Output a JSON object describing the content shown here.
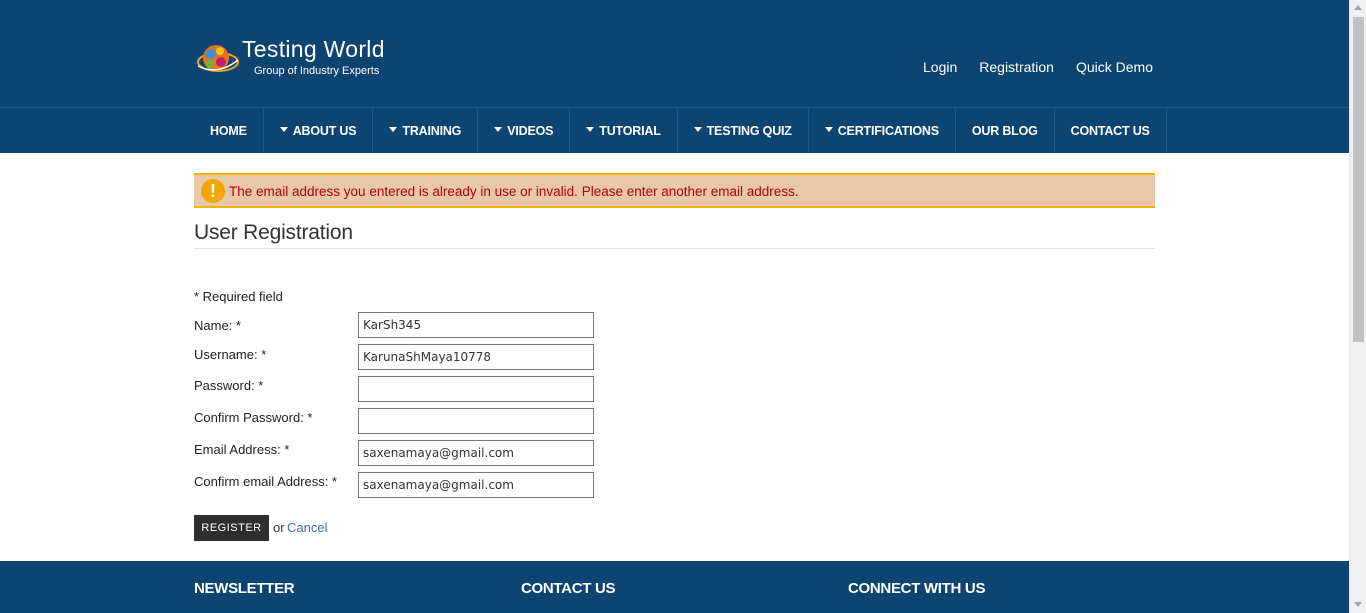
{
  "header": {
    "logo_title": "Testing World",
    "logo_subtitle": "Group of Industry Experts",
    "top_links": [
      "Login",
      "Registration",
      "Quick Demo"
    ]
  },
  "nav": {
    "items": [
      {
        "label": "HOME",
        "dropdown": false
      },
      {
        "label": "ABOUT US",
        "dropdown": true
      },
      {
        "label": "TRAINING",
        "dropdown": true
      },
      {
        "label": "VIDEOS",
        "dropdown": true
      },
      {
        "label": "TUTORIAL",
        "dropdown": true
      },
      {
        "label": "TESTING QUIZ",
        "dropdown": true
      },
      {
        "label": "CERTIFICATIONS",
        "dropdown": true
      },
      {
        "label": "OUR BLOG",
        "dropdown": false
      },
      {
        "label": "CONTACT US",
        "dropdown": false
      }
    ]
  },
  "alert": {
    "icon": "exclamation-icon",
    "message": "The email address you entered is already in use or invalid. Please enter another email address."
  },
  "form": {
    "title": "User Registration",
    "required_note": "* Required field",
    "fields": {
      "name": {
        "label": "Name: *",
        "value": "KarSh345"
      },
      "username": {
        "label": "Username: *",
        "value": "KarunaShMaya10778"
      },
      "password": {
        "label": "Password: *",
        "value": ""
      },
      "confirm_password": {
        "label": "Confirm Password: *",
        "value": ""
      },
      "email": {
        "label": "Email Address: *",
        "value": "saxenamaya@gmail.com"
      },
      "confirm_email": {
        "label": "Confirm email Address: *",
        "value": "saxenamaya@gmail.com"
      }
    },
    "register_label": "REGISTER",
    "or_text": "or",
    "cancel_label": "Cancel"
  },
  "footer": {
    "headings": [
      "NEWSLETTER",
      "CONTACT US",
      "CONNECT WITH US"
    ]
  },
  "colors": {
    "brand_navy": "#0d4471",
    "alert_bg": "#e8c8a8",
    "alert_border": "#f0b400",
    "alert_text": "#b3000c",
    "link_blue": "#3a6ea5"
  }
}
